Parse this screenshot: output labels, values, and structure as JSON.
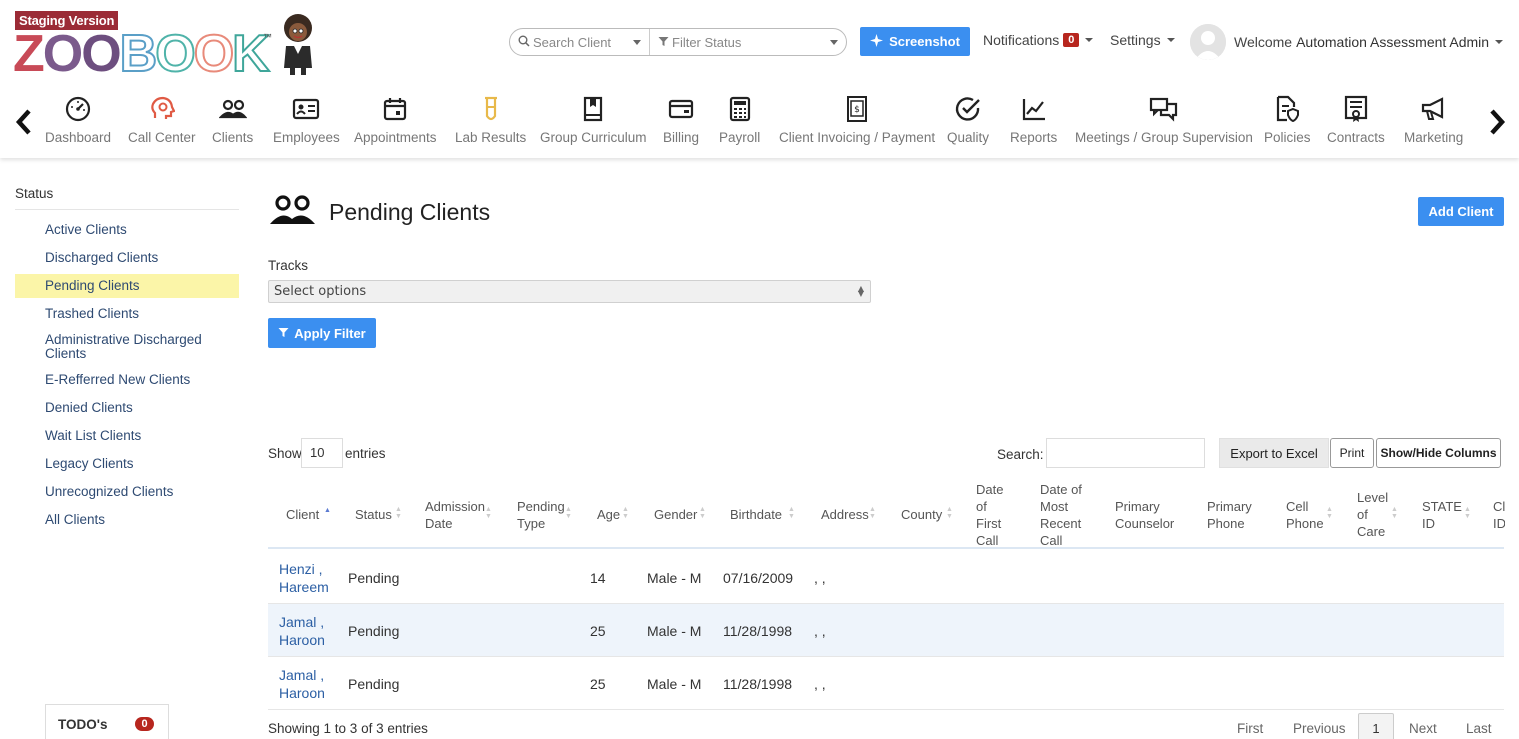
{
  "header": {
    "staging_label": "Staging Version",
    "logo_text": [
      "ZOO",
      "BOOK"
    ],
    "trademark": "™",
    "search_client_placeholder": "Search Client",
    "filter_status_placeholder": "Filter Status",
    "screenshot_label": "Screenshot",
    "notifications_label": "Notifications",
    "notifications_count": "0",
    "settings_label": "Settings",
    "welcome_prefix": "Welcome",
    "user_name": "Automation Assessment Admin"
  },
  "nav": [
    {
      "label": "Dashboard",
      "icon": "gauge-icon"
    },
    {
      "label": "Call Center",
      "icon": "head-icon"
    },
    {
      "label": "Clients",
      "icon": "users-icon"
    },
    {
      "label": "Employees",
      "icon": "id-card-icon"
    },
    {
      "label": "Appointments",
      "icon": "calendar-icon"
    },
    {
      "label": "Lab Results",
      "icon": "test-tube-icon"
    },
    {
      "label": "Group Curriculum",
      "icon": "book-icon"
    },
    {
      "label": "Billing",
      "icon": "wallet-icon"
    },
    {
      "label": "Payroll",
      "icon": "calculator-icon"
    },
    {
      "label": "Client Invoicing / Payment",
      "icon": "invoice-icon"
    },
    {
      "label": "Quality",
      "icon": "check-circle-icon"
    },
    {
      "label": "Reports",
      "icon": "line-chart-icon"
    },
    {
      "label": "Meetings / Group Supervision",
      "icon": "chat-icon"
    },
    {
      "label": "Policies",
      "icon": "policy-icon"
    },
    {
      "label": "Contracts",
      "icon": "contract-icon"
    },
    {
      "label": "Marketing",
      "icon": "megaphone-icon"
    }
  ],
  "sidebar": {
    "title": "Status",
    "items": [
      {
        "label": "Active Clients"
      },
      {
        "label": "Discharged Clients"
      },
      {
        "label": "Pending Clients"
      },
      {
        "label": "Trashed Clients"
      },
      {
        "label": "Administrative Discharged Clients"
      },
      {
        "label": "E-Refferred New Clients"
      },
      {
        "label": "Denied Clients"
      },
      {
        "label": "Wait List Clients"
      },
      {
        "label": "Legacy Clients"
      },
      {
        "label": "Unrecognized Clients"
      },
      {
        "label": "All Clients"
      }
    ],
    "active_index": 2,
    "todo_label": "TODO's",
    "todo_count": "0"
  },
  "main": {
    "title": "Pending Clients",
    "add_client_label": "Add Client",
    "tracks_label": "Tracks",
    "tracks_placeholder": "Select options",
    "apply_filter_label": "Apply Filter",
    "show_label": "Show",
    "show_value": "10",
    "entries_label": "entries",
    "search_label": "Search:",
    "export_label": "Export to Excel",
    "print_label": "Print",
    "showhide_label": "Show/Hide Columns"
  },
  "table": {
    "columns": [
      "Client",
      "Status",
      "Admission Date",
      "Pending Type",
      "Age",
      "Gender",
      "Birthdate",
      "Address",
      "County",
      "Date of First Call",
      "Date of Most Recent Call",
      "Primary Counselor",
      "Primary Phone",
      "Cell Phone",
      "Level of Care",
      "STATE ID",
      "Cl ID"
    ],
    "rows": [
      {
        "client": "Henzi , Hareem",
        "status": "Pending",
        "age": "14",
        "gender": "Male - M",
        "birthdate": "07/16/2009",
        "address": ", ,"
      },
      {
        "client": "Jamal , Haroon",
        "status": "Pending",
        "age": "25",
        "gender": "Male - M",
        "birthdate": "11/28/1998",
        "address": ", ,"
      },
      {
        "client": "Jamal , Haroon",
        "status": "Pending",
        "age": "25",
        "gender": "Male - M",
        "birthdate": "11/28/1998",
        "address": ", ,"
      }
    ],
    "showing_text": "Showing 1 to 3 of 3 entries",
    "pagination": {
      "first": "First",
      "previous": "Previous",
      "current": "1",
      "next": "Next",
      "last": "Last"
    }
  },
  "colors": {
    "accent": "#3b8ff0",
    "badge": "#b7261e",
    "active_bg": "#fbf5a8",
    "link": "#2c5fa4"
  }
}
